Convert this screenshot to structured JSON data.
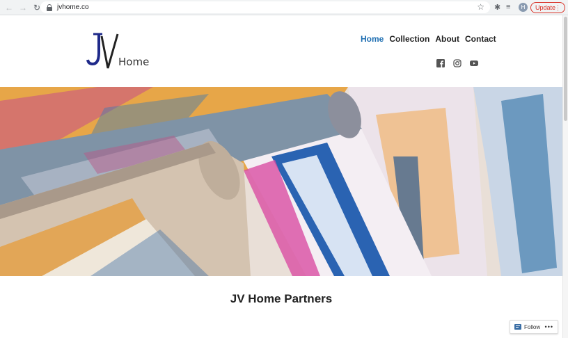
{
  "browser": {
    "url": "jvhome.co",
    "profile_initial": "H",
    "update_label": "Update",
    "update_menu": "⋮"
  },
  "site": {
    "logo_word": "Home",
    "nav": [
      "Home",
      "Collection",
      "About",
      "Contact"
    ],
    "active_nav": "Home",
    "social_icons": [
      "facebook-icon",
      "instagram-icon",
      "youtube-icon"
    ],
    "hero_alt": "Colorful rugs",
    "headline": "JV Home Partners"
  },
  "follow_widget": {
    "label": "Follow",
    "more": "•••"
  },
  "colors": {
    "accent": "#1f6fb2",
    "update": "#d93025",
    "logo_blue": "#1f2a8a"
  }
}
